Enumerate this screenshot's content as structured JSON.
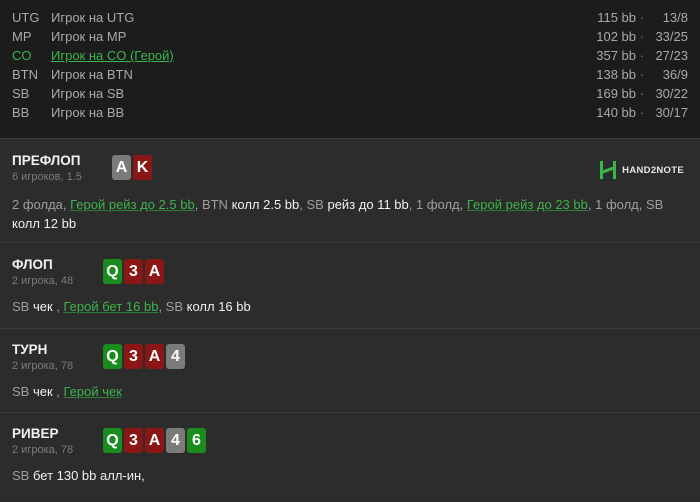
{
  "players": [
    {
      "pos": "UTG",
      "name": "Игрок на UTG",
      "stack": "115 bb",
      "stat": "13/8",
      "hero": false
    },
    {
      "pos": "MP",
      "name": "Игрок на MP",
      "stack": "102 bb",
      "stat": "33/25",
      "hero": false
    },
    {
      "pos": "CO",
      "name": "Игрок на CO (Герой)",
      "stack": "357 bb",
      "stat": "27/23",
      "hero": true
    },
    {
      "pos": "BTN",
      "name": "Игрок на BTN",
      "stack": "138 bb",
      "stat": "36/9",
      "hero": false
    },
    {
      "pos": "SB",
      "name": "Игрок на SB",
      "stack": "169 bb",
      "stat": "30/22",
      "hero": false
    },
    {
      "pos": "BB",
      "name": "Игрок на BB",
      "stack": "140 bb",
      "stat": "30/17",
      "hero": false
    }
  ],
  "separator": "·",
  "logo": {
    "text": "HAND2NOTE",
    "color": "#39b54a"
  },
  "preflop": {
    "title": "ПРЕФЛОП",
    "sub": "6 игроков, 1.5",
    "cards": [
      {
        "rank": "A",
        "color": "gray"
      },
      {
        "rank": "K",
        "color": "red"
      }
    ],
    "line1": [
      {
        "t": "2 фолда, ",
        "c": "g"
      },
      {
        "t": "Герой рейз до 2.5 bb",
        "c": "h"
      },
      {
        "t": ", BTN ",
        "c": "g"
      },
      {
        "t": "колл 2.5 bb",
        "c": "w"
      },
      {
        "t": ", SB ",
        "c": "g"
      },
      {
        "t": "рейз до 11 bb",
        "c": "w"
      },
      {
        "t": ", 1 фолд, ",
        "c": "g"
      },
      {
        "t": "Герой рейз до 23 bb",
        "c": "h"
      },
      {
        "t": ", 1 фолд, SB",
        "c": "g"
      }
    ],
    "line2": [
      {
        "t": "колл 12 bb",
        "c": "w"
      }
    ]
  },
  "flop": {
    "title": "ФЛОП",
    "sub": "2 игрока, 48",
    "cards": [
      {
        "rank": "Q",
        "color": "green"
      },
      {
        "rank": "3",
        "color": "red"
      },
      {
        "rank": "A",
        "color": "red"
      }
    ],
    "line1": [
      {
        "t": "SB ",
        "c": "g"
      },
      {
        "t": "чек",
        "c": "w"
      },
      {
        "t": " , ",
        "c": "g"
      },
      {
        "t": "Герой бет 16 bb",
        "c": "h"
      },
      {
        "t": ", SB ",
        "c": "g"
      },
      {
        "t": "колл 16 bb",
        "c": "w"
      }
    ]
  },
  "turn": {
    "title": "ТУРН",
    "sub": "2 игрока, 78",
    "cards": [
      {
        "rank": "Q",
        "color": "green"
      },
      {
        "rank": "3",
        "color": "red"
      },
      {
        "rank": "A",
        "color": "red"
      },
      {
        "rank": "4",
        "color": "gray"
      }
    ],
    "line1": [
      {
        "t": "SB ",
        "c": "g"
      },
      {
        "t": "чек",
        "c": "w"
      },
      {
        "t": " , ",
        "c": "g"
      },
      {
        "t": "Герой чек",
        "c": "h"
      }
    ]
  },
  "river": {
    "title": "РИВЕР",
    "sub": "2 игрока, 78",
    "cards": [
      {
        "rank": "Q",
        "color": "green"
      },
      {
        "rank": "3",
        "color": "red"
      },
      {
        "rank": "A",
        "color": "red"
      },
      {
        "rank": "4",
        "color": "gray"
      },
      {
        "rank": "6",
        "color": "green"
      }
    ],
    "line1": [
      {
        "t": "SB ",
        "c": "g"
      },
      {
        "t": "бет 130 bb алл-ин,",
        "c": "w"
      }
    ]
  }
}
